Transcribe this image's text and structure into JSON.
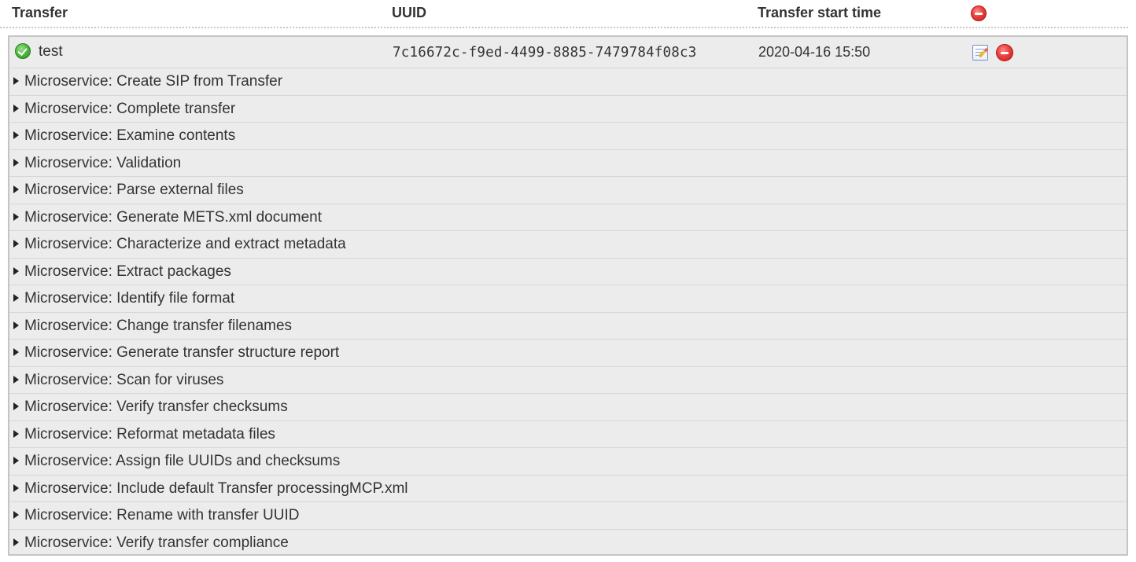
{
  "header": {
    "transfer_label": "Transfer",
    "uuid_label": "UUID",
    "start_time_label": "Transfer start time",
    "remove_all_icon": "remove-icon"
  },
  "transfer": {
    "name": "test",
    "uuid": "7c16672c-f9ed-4499-8885-7479784f08c3",
    "start_time": "2020-04-16 15:50",
    "status_icon": "check-circle-icon",
    "status_color": "#4cb83a"
  },
  "microservices": [
    {
      "label": "Microservice: Create SIP from Transfer"
    },
    {
      "label": "Microservice: Complete transfer"
    },
    {
      "label": "Microservice: Examine contents"
    },
    {
      "label": "Microservice: Validation"
    },
    {
      "label": "Microservice: Parse external files"
    },
    {
      "label": "Microservice: Generate METS.xml document"
    },
    {
      "label": "Microservice: Characterize and extract metadata"
    },
    {
      "label": "Microservice: Extract packages"
    },
    {
      "label": "Microservice: Identify file format"
    },
    {
      "label": "Microservice: Change transfer filenames"
    },
    {
      "label": "Microservice: Generate transfer structure report"
    },
    {
      "label": "Microservice: Scan for viruses"
    },
    {
      "label": "Microservice: Verify transfer checksums"
    },
    {
      "label": "Microservice: Reformat metadata files"
    },
    {
      "label": "Microservice: Assign file UUIDs and checksums"
    },
    {
      "label": "Microservice: Include default Transfer processingMCP.xml"
    },
    {
      "label": "Microservice: Rename with transfer UUID"
    },
    {
      "label": "Microservice: Verify transfer compliance"
    }
  ],
  "colors": {
    "panel_background": "#ececec",
    "remove_red": "#e8403d"
  }
}
